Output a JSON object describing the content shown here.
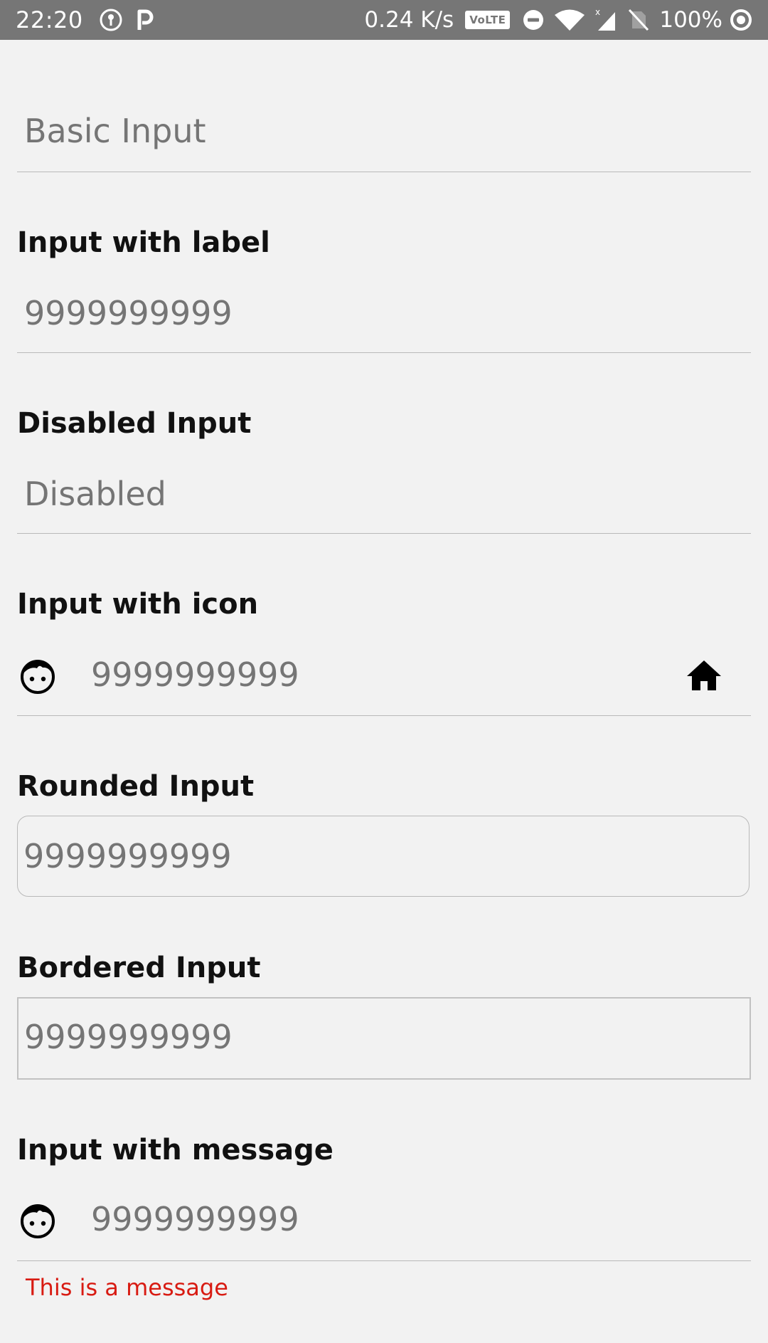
{
  "status_bar": {
    "time": "22:20",
    "network_speed": "0.24 K/s",
    "volte": "VoLTE",
    "battery": "100%",
    "icons": [
      "location-icon",
      "parking-icon",
      "dnd-icon",
      "wifi-icon",
      "signal-icon",
      "no-sim-icon",
      "sync-icon"
    ]
  },
  "form": {
    "basic_input": {
      "placeholder": "Basic Input"
    },
    "input_with_label": {
      "label": "Input with label",
      "placeholder": "9999999999"
    },
    "disabled_input": {
      "label": "Disabled Input",
      "placeholder": "Disabled"
    },
    "input_with_icon": {
      "label": "Input with icon",
      "placeholder": "9999999999",
      "left_icon": "face-icon",
      "right_icon": "home-icon"
    },
    "rounded_input": {
      "label": "Rounded Input",
      "placeholder": "9999999999"
    },
    "bordered_input": {
      "label": "Bordered Input",
      "placeholder": "9999999999"
    },
    "input_with_message": {
      "label": "Input with message",
      "placeholder": "9999999999",
      "left_icon": "face-icon",
      "message": "This is a message"
    }
  },
  "colors": {
    "background": "#f2f2f2",
    "status_bar": "#767676",
    "label": "#111111",
    "placeholder": "#8b8b8b",
    "divider": "#b9b9b9",
    "message": "#d81b12"
  }
}
